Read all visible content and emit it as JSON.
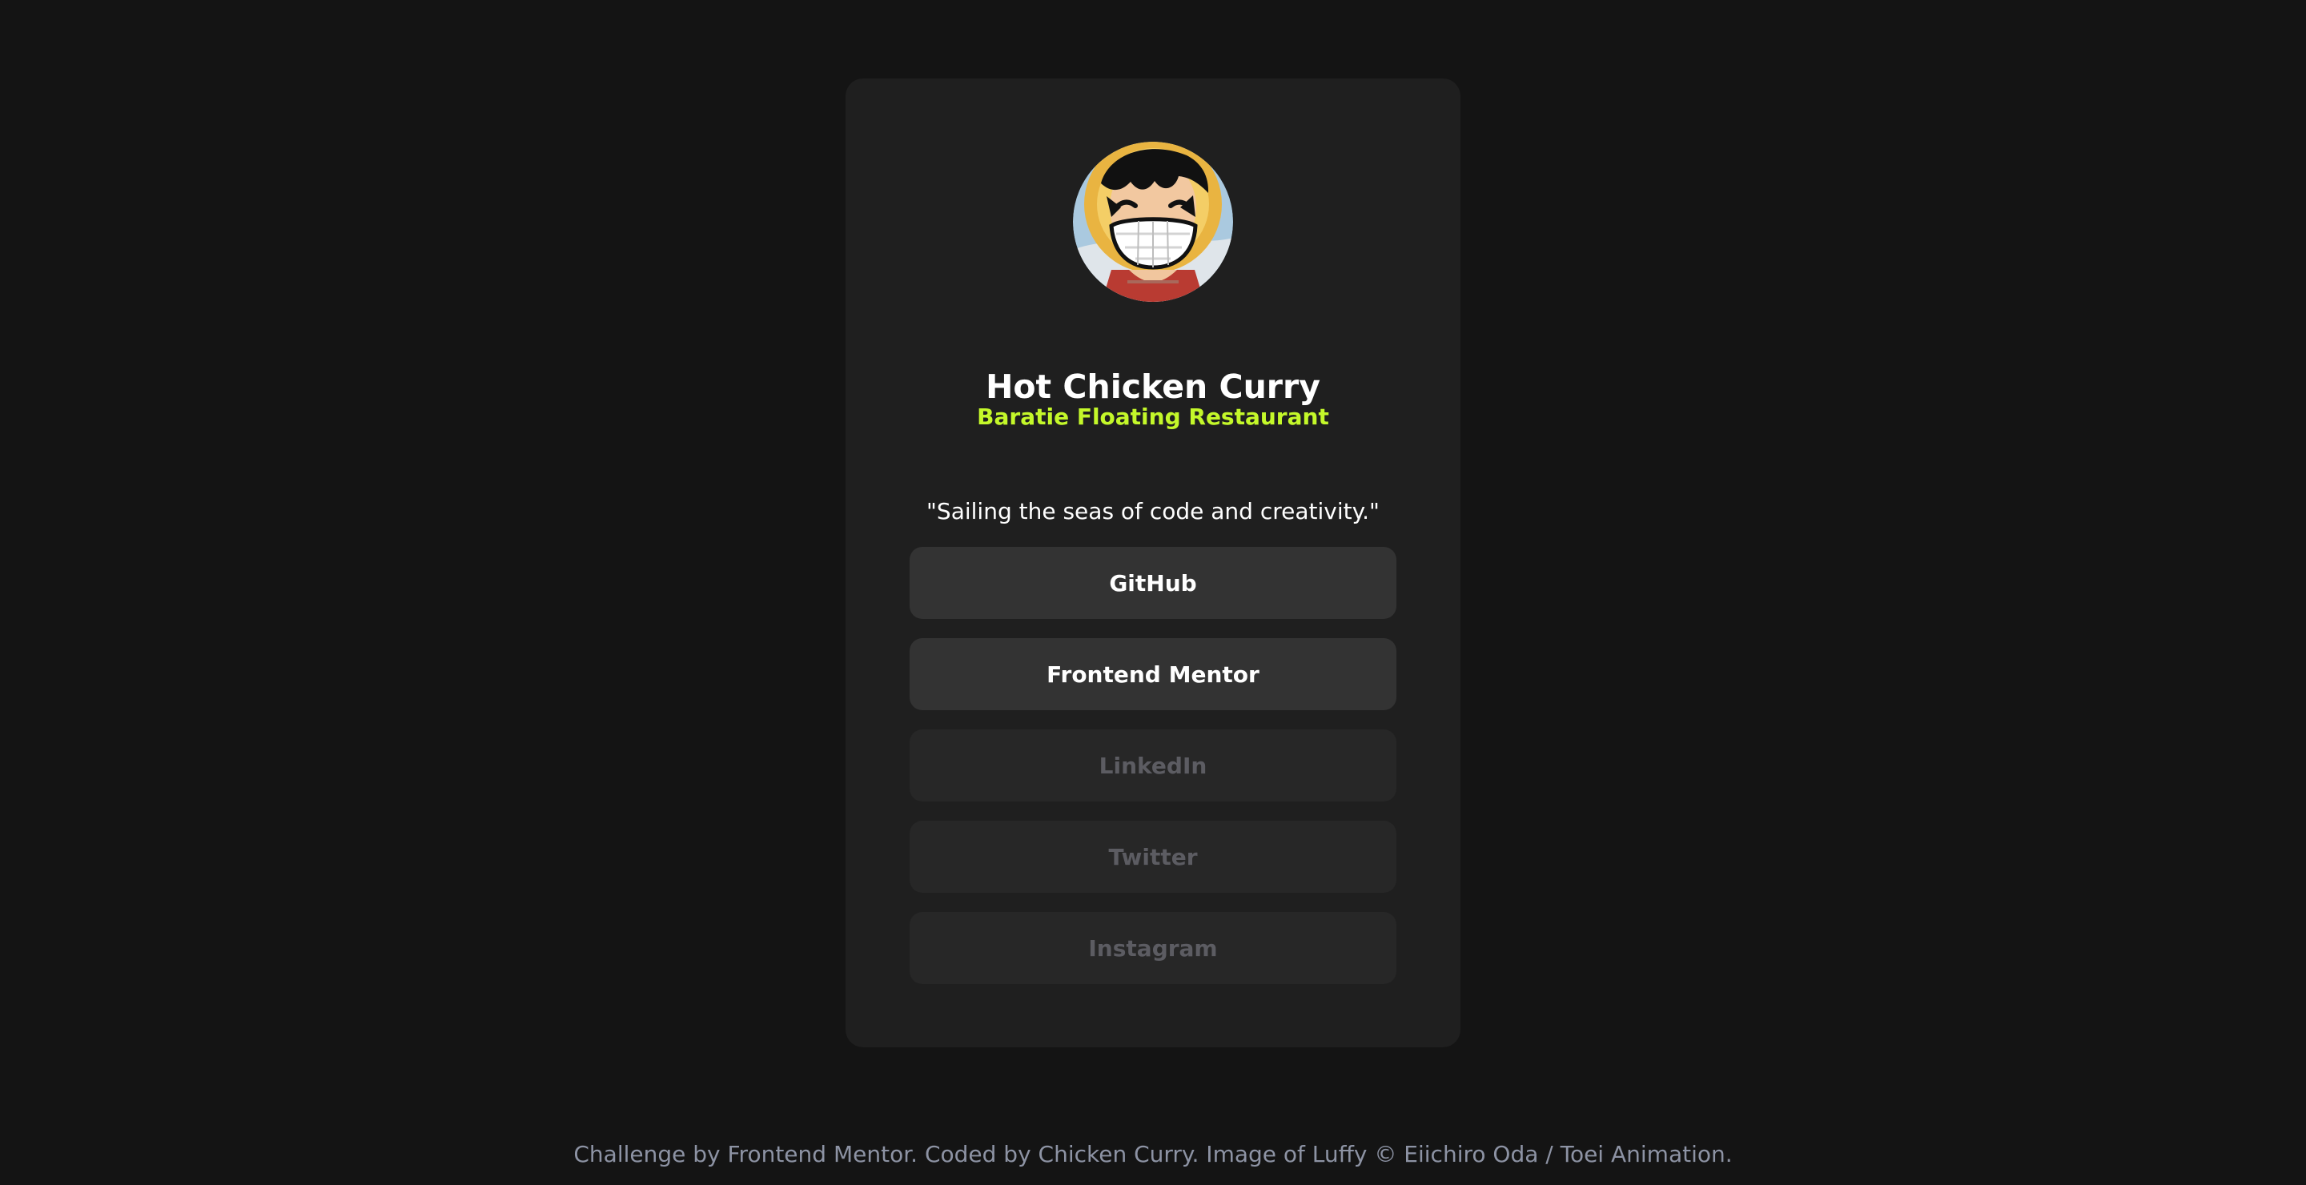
{
  "profile": {
    "avatar_icon": "luffy-avatar-image",
    "name": "Hot Chicken Curry",
    "location": "Baratie Floating Restaurant",
    "bio": "\"Sailing the seas of code and creativity.\""
  },
  "links": [
    {
      "label": "GitHub",
      "state": "active"
    },
    {
      "label": "Frontend Mentor",
      "state": "active"
    },
    {
      "label": "LinkedIn",
      "state": "muted"
    },
    {
      "label": "Twitter",
      "state": "muted"
    },
    {
      "label": "Instagram",
      "state": "muted"
    }
  ],
  "footer": {
    "text": "Challenge by Frontend Mentor. Coded by Chicken Curry. Image of Luffy © Eiichiro Oda / Toei Animation."
  },
  "colors": {
    "page_background": "#141414",
    "card_background": "#1f1f1f",
    "active_button": "#333333",
    "muted_button": "#272727",
    "accent": "#c4f82a",
    "muted_text": "#5c5c62",
    "footer_text": "#8d93a4"
  }
}
